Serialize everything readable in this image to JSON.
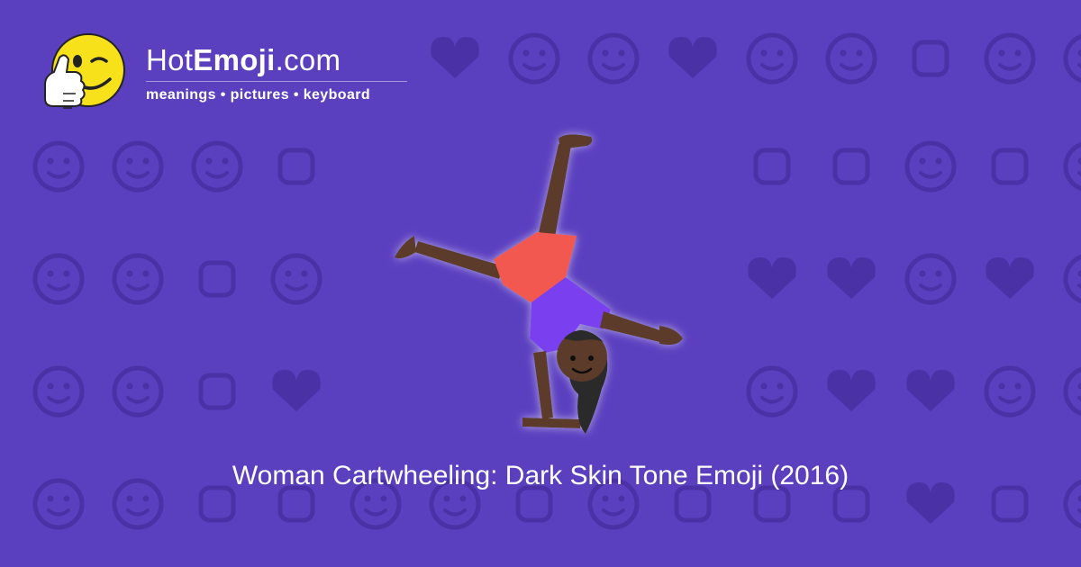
{
  "site": {
    "brand_prefix": "Hot",
    "brand_bold": "Emoji",
    "brand_suffix": ".com",
    "tagline": "meanings • pictures • keyboard"
  },
  "emoji": {
    "name": "Woman Cartwheeling: Dark Skin Tone Emoji (2016)"
  },
  "colors": {
    "background": "#5a3fbf",
    "pattern": "#4b31a6",
    "logo_face": "#f7e11b",
    "shorts": "#f2584f",
    "shirt": "#7a3ff0",
    "skin": "#5b3a2a",
    "hair": "#2a2a2a"
  },
  "background_pattern_icons": [
    "heart-eyes-face-icon",
    "winking-face-icon",
    "kissing-face-icon",
    "two-hearts-icon",
    "smiling-face-icon",
    "weary-face-icon",
    "ok-hand-icon",
    "expressionless-face-icon",
    "eyes-icon",
    "smirking-face-icon",
    "relieved-face-icon",
    "grimacing-face-icon",
    "recycle-icon",
    "raising-hands-icon",
    "music-notes-icon",
    "see-no-evil-monkey-icon",
    "victory-hand-icon",
    "sleeping-face-icon",
    "disappointed-face-icon",
    "grinning-face-icon",
    "sparkles-icon",
    "grinning-face-icon",
    "striped-heart-icon",
    "broken-heart-icon",
    "confused-face-icon",
    "striped-heart-icon",
    "tongue-wink-face-icon",
    "frowning-face-icon",
    "smiling-face-icon",
    "raised-hands-icon",
    "heart-arrow-icon",
    "weary-face-icon",
    "revolving-hearts-icon",
    "heart-icon",
    "monkey-icon",
    "scream-face-icon",
    "cat-face-icon",
    "angry-face-icon",
    "left-arrow-icon",
    "fire-icon",
    "grinning-face-icon",
    "confounded-face-icon",
    "party-popper-icon",
    "tongue-face-icon",
    "rose-icon",
    "sun-icon",
    "flexed-biceps-icon",
    "striped-heart-icon",
    "check-mark-icon",
    "grinning-face-icon",
    "smiling-face-icon",
    "cat-face-icon",
    "waving-hand-icon",
    "grinning-face-icon",
    "camera-icon",
    "frowning-face-icon",
    "grinning-face-icon",
    "heart-icon",
    "kissing-face-icon",
    "kissing-face-icon"
  ]
}
